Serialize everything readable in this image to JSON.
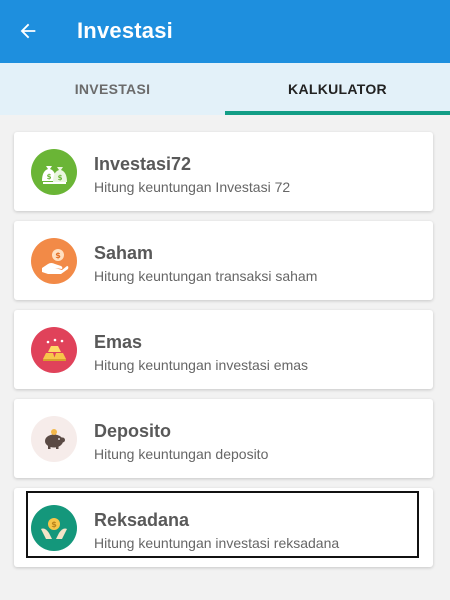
{
  "appbar": {
    "title": "Investasi",
    "back_icon": "arrow-left-icon"
  },
  "tabs": [
    {
      "label": "INVESTASI",
      "active": false
    },
    {
      "label": "KALKULATOR",
      "active": true
    }
  ],
  "accent_colors": {
    "appbar": "#1e8fde",
    "tab_indicator": "#139e86"
  },
  "calculators": [
    {
      "title": "Investasi72",
      "subtitle": "Hitung keuntungan Investasi 72",
      "icon": "money-bags-icon",
      "icon_color": "#6ab536"
    },
    {
      "title": "Saham",
      "subtitle": "Hitung keuntungan transaksi saham",
      "icon": "hand-coin-icon",
      "icon_color": "#f28a47"
    },
    {
      "title": "Emas",
      "subtitle": "Hitung keuntungan investasi emas",
      "icon": "gold-bars-icon",
      "icon_color": "#e0425a"
    },
    {
      "title": "Deposito",
      "subtitle": "Hitung keuntungan deposito",
      "icon": "piggy-bank-icon",
      "icon_color": "#f6ecea"
    },
    {
      "title": "Reksadana",
      "subtitle": "Hitung keuntungan investasi reksadana",
      "icon": "hands-coin-icon",
      "icon_color": "#14977b"
    }
  ]
}
